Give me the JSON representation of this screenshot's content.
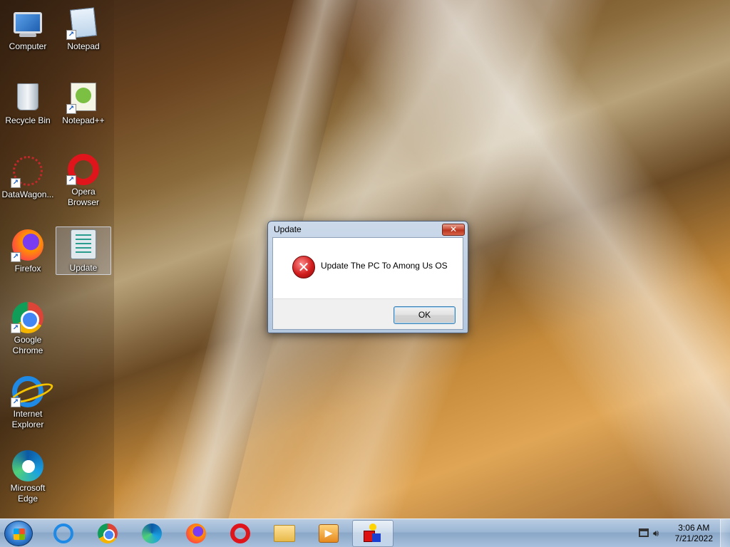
{
  "desktop": {
    "icons": [
      {
        "label": "Computer",
        "icon": "computer-icon"
      },
      {
        "label": "Notepad",
        "icon": "notepad-icon"
      },
      {
        "label": "Recycle Bin",
        "icon": "recycle-bin-icon"
      },
      {
        "label": "Notepad++",
        "icon": "notepad-plus-plus-icon"
      },
      {
        "label": "DataWagon...",
        "icon": "datawagon-icon"
      },
      {
        "label": "Opera Browser",
        "icon": "opera-icon"
      },
      {
        "label": "Firefox",
        "icon": "firefox-icon"
      },
      {
        "label": "Update",
        "icon": "script-file-icon",
        "selected": true
      },
      {
        "label": "Google Chrome",
        "icon": "chrome-icon"
      },
      {
        "label": "Internet Explorer",
        "icon": "internet-explorer-icon"
      },
      {
        "label": "Microsoft Edge",
        "icon": "edge-icon"
      }
    ]
  },
  "dialog": {
    "title": "Update",
    "close_label": "✕",
    "message": "Update The PC To Among Us OS",
    "ok_label": "OK",
    "icon": "error-icon"
  },
  "taskbar": {
    "pinned": [
      "internet-explorer-icon",
      "chrome-icon",
      "edge-icon",
      "firefox-icon",
      "opera-icon",
      "file-explorer-icon",
      "media-player-icon",
      "running-app-icon"
    ],
    "clock": {
      "time": "3:06 AM",
      "date": "7/21/2022"
    }
  },
  "colors": {
    "taskbar": "#9bb6d4",
    "close_button": "#c84530",
    "error": "#d21d1d",
    "ok_border": "#3c7fb1"
  }
}
